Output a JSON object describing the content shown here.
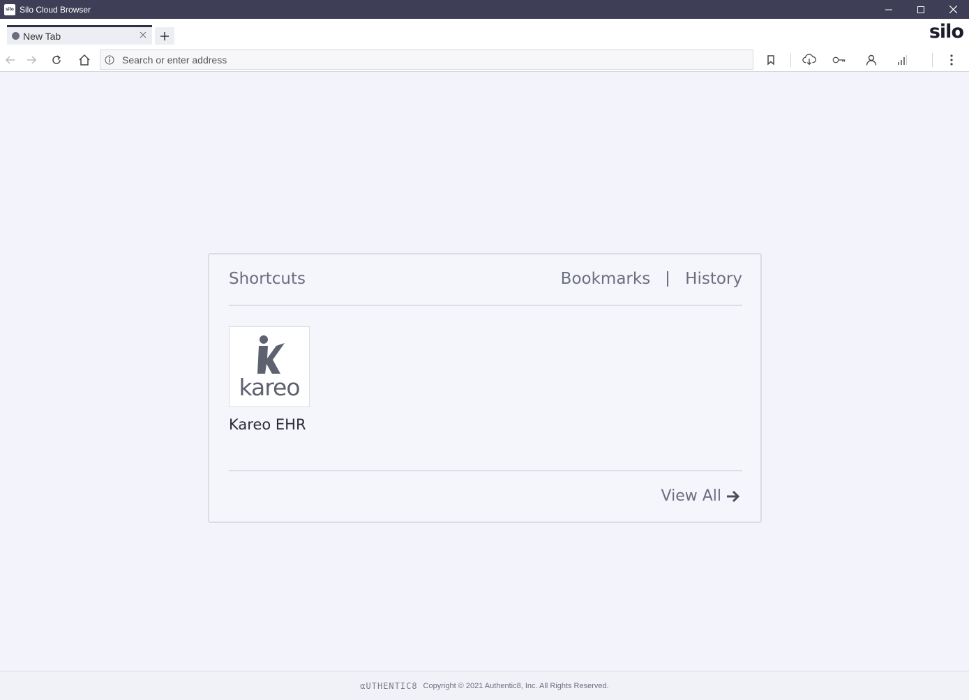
{
  "window": {
    "app_icon_text": "silo",
    "title": "Silo Cloud Browser"
  },
  "tabs": [
    {
      "label": "New Tab",
      "active": true
    }
  ],
  "brand": "silo",
  "address_bar": {
    "value": "",
    "placeholder": "Search or enter address"
  },
  "toolbar_icons": [
    "back-icon",
    "forward-icon",
    "reload-icon",
    "home-icon",
    "bookmark-icon",
    "cloud-download-icon",
    "key-icon",
    "user-icon",
    "signal-icon",
    "more-icon"
  ],
  "card": {
    "shortcuts_label": "Shortcuts",
    "bookmarks_label": "Bookmarks",
    "history_label": "History",
    "shortcuts": [
      {
        "logo_text": "kareo",
        "label": "Kareo EHR"
      }
    ],
    "view_all_label": "View All"
  },
  "footer": {
    "brand": "αUTHENTIC8",
    "copyright": "Copyright © 2021 Authentic8, Inc. All Rights Reserved."
  },
  "colors": {
    "titlebar": "#3e3f56",
    "page_background": "#f3f4fb",
    "accent_text": "#6c6e80"
  }
}
